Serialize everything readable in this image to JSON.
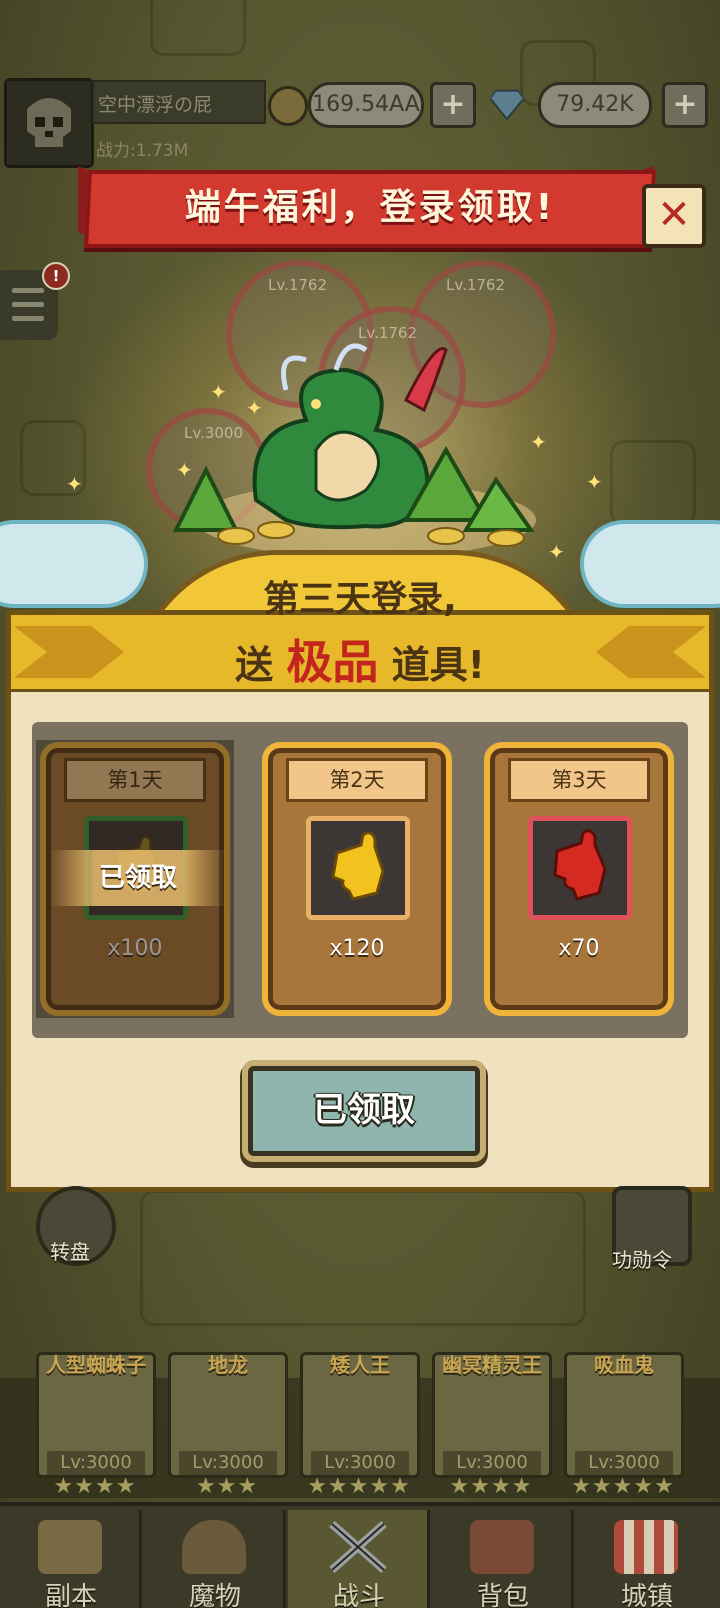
{
  "header": {
    "player_name": "空中漂浮の屁",
    "power_label": "战力:1.73M",
    "gold": "169.54AA",
    "gems": "79.42K",
    "plus": "+"
  },
  "event": {
    "banner_title": "端午福利，登录领取!",
    "close_glyph": "✕",
    "headline_line1": "第三天登录,",
    "headline_prefix": "送",
    "headline_highlight": "极品",
    "headline_suffix": "道具!",
    "ghost_levels": [
      "Lv.1762",
      "Lv.1762",
      "Lv.1762",
      "Lv.3000"
    ],
    "days": [
      {
        "label": "第1天",
        "qty": "x100",
        "claimed_label": "已领取",
        "item_color": "#c9a22a",
        "frame_color": "#3e9a44"
      },
      {
        "label": "第2天",
        "qty": "x120",
        "item_color": "#f2c21e",
        "frame_color": "#e8b064"
      },
      {
        "label": "第3天",
        "qty": "x70",
        "item_color": "#d42a22",
        "frame_color": "#e0525a"
      }
    ],
    "claim_button": "已领取"
  },
  "side": {
    "left_label": "转盘",
    "right_label": "功勋令"
  },
  "heroes": [
    {
      "name": "人型蜘蛛子",
      "level": "Lv:3000",
      "stars": "★★★★"
    },
    {
      "name": "地龙",
      "level": "Lv:3000",
      "stars": "★★★"
    },
    {
      "name": "矮人王",
      "level": "Lv:3000",
      "stars": "★★★★★"
    },
    {
      "name": "幽冥精灵王",
      "level": "Lv:3000",
      "stars": "★★★★"
    },
    {
      "name": "吸血鬼",
      "level": "Lv:3000",
      "stars": "★★★★★"
    }
  ],
  "nav": [
    {
      "label": "副本",
      "icon": "map-icon"
    },
    {
      "label": "魔物",
      "icon": "monster-helmet-icon"
    },
    {
      "label": "战斗",
      "icon": "crossed-swords-icon"
    },
    {
      "label": "背包",
      "icon": "backpack-icon"
    },
    {
      "label": "城镇",
      "icon": "town-shop-icon"
    }
  ],
  "colors": {
    "banner_red": "#d23a30",
    "panel_gold": "#e6b82a",
    "highlight_red": "#c2261c",
    "claim_button": "#8fb6ae"
  }
}
